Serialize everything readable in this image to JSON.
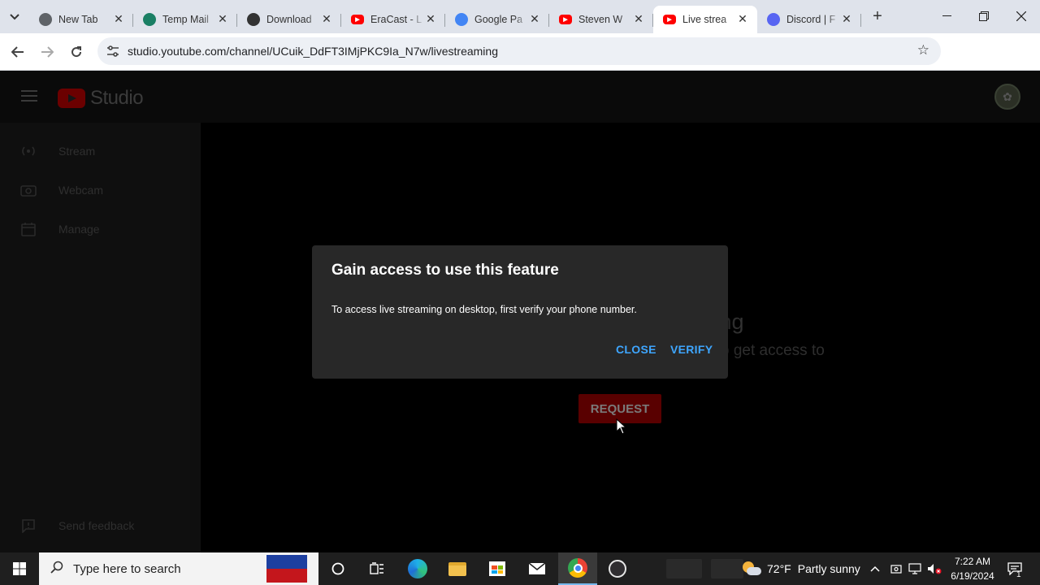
{
  "browser": {
    "tabs": [
      {
        "title": "New Tab",
        "favicon": "chrome-icon",
        "color": "#5f6368"
      },
      {
        "title": "Temp Mail",
        "favicon": "tempmail-icon",
        "color": "#1a7f64"
      },
      {
        "title": "Download",
        "favicon": "download-site-icon",
        "color": "#333333"
      },
      {
        "title": "EraCast - L",
        "favicon": "youtube-icon",
        "color": "#ff0000"
      },
      {
        "title": "Google Pa",
        "favicon": "google-icon",
        "color": "#4285f4"
      },
      {
        "title": "Steven W",
        "favicon": "youtube-icon",
        "color": "#ff0000"
      },
      {
        "title": "Live strea",
        "favicon": "youtube-icon",
        "color": "#ff0000",
        "active": true
      },
      {
        "title": "Discord | F",
        "favicon": "discord-icon",
        "color": "#5865f2"
      }
    ],
    "url": "studio.youtube.com/channel/UCuik_DdFT3IMjPKC9Ia_N7w/livestreaming"
  },
  "studio": {
    "logo_text": "Studio",
    "sidebar": [
      {
        "label": "Stream",
        "icon": "broadcast-icon"
      },
      {
        "label": "Webcam",
        "icon": "camera-icon"
      },
      {
        "label": "Manage",
        "icon": "calendar-icon"
      }
    ],
    "feedback_label": "Send feedback",
    "background_title": "ming",
    "background_sub": "o get access to",
    "request_button": "REQUEST"
  },
  "dialog": {
    "title": "Gain access to use this feature",
    "body": "To access live streaming on desktop, first verify your phone number.",
    "close_label": "CLOSE",
    "verify_label": "VERIFY"
  },
  "taskbar": {
    "search_placeholder": "Type here to search",
    "weather_temp": "72°F",
    "weather_text": "Partly sunny",
    "time": "7:22 AM",
    "date": "6/19/2024",
    "notification_count": "1"
  }
}
